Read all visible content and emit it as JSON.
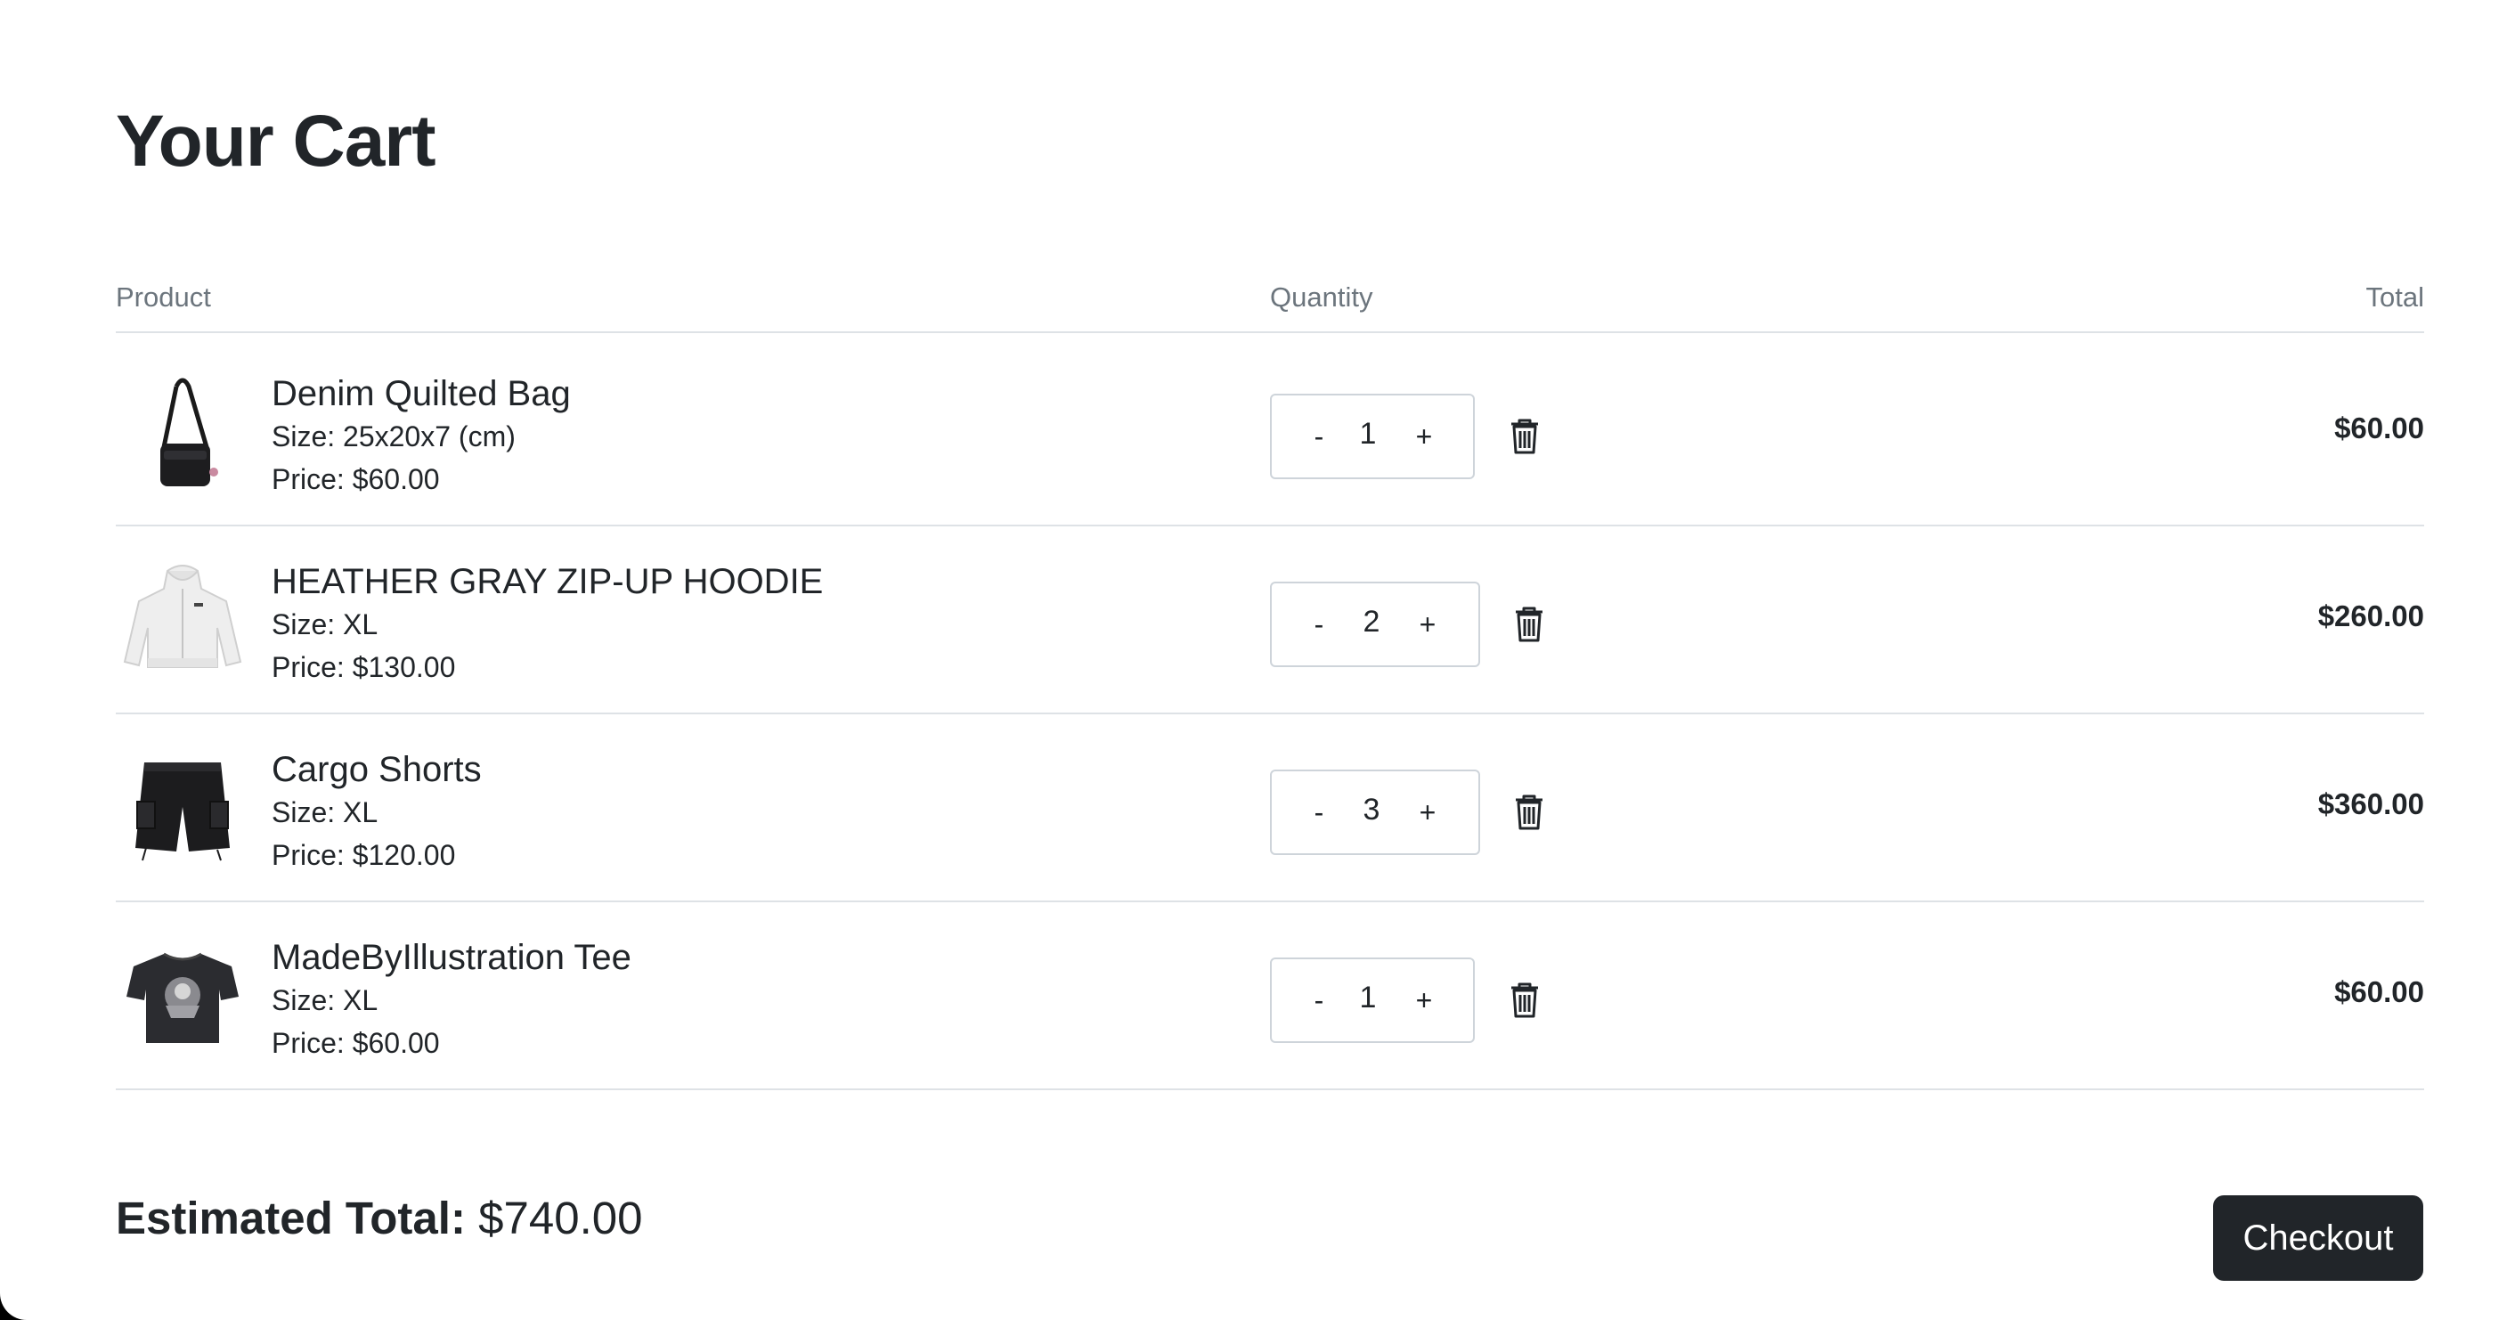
{
  "page": {
    "title": "Your Cart"
  },
  "table": {
    "headers": {
      "product": "Product",
      "quantity": "Quantity",
      "total": "Total"
    }
  },
  "items": [
    {
      "name": "Denim Quilted Bag",
      "size": "Size: 25x20x7 (cm)",
      "price": "Price: $60.00",
      "quantity": "1",
      "minus": "-",
      "plus": "+",
      "total": "$60.00",
      "thumbnail_icon": "crossbody-bag-icon"
    },
    {
      "name": "HEATHER GRAY ZIP-UP HOODIE",
      "size": "Size: XL",
      "price": "Price: $130.00",
      "quantity": "2",
      "minus": "-",
      "plus": "+",
      "total": "$260.00",
      "thumbnail_icon": "hoodie-icon"
    },
    {
      "name": "Cargo Shorts",
      "size": "Size: XL",
      "price": "Price: $120.00",
      "quantity": "3",
      "minus": "-",
      "plus": "+",
      "total": "$360.00",
      "thumbnail_icon": "shorts-icon"
    },
    {
      "name": "MadeByIllustration Tee",
      "size": "Size: XL",
      "price": "Price: $60.00",
      "quantity": "1",
      "minus": "-",
      "plus": "+",
      "total": "$60.00",
      "thumbnail_icon": "tshirt-icon"
    }
  ],
  "summary": {
    "label": "Estimated Total:",
    "value": "$740.00"
  },
  "checkout": {
    "label": "Checkout"
  },
  "colors": {
    "text": "#212529",
    "muted": "#6c757d",
    "border": "#dee2e6",
    "button_bg": "#212529",
    "button_text": "#ffffff"
  }
}
